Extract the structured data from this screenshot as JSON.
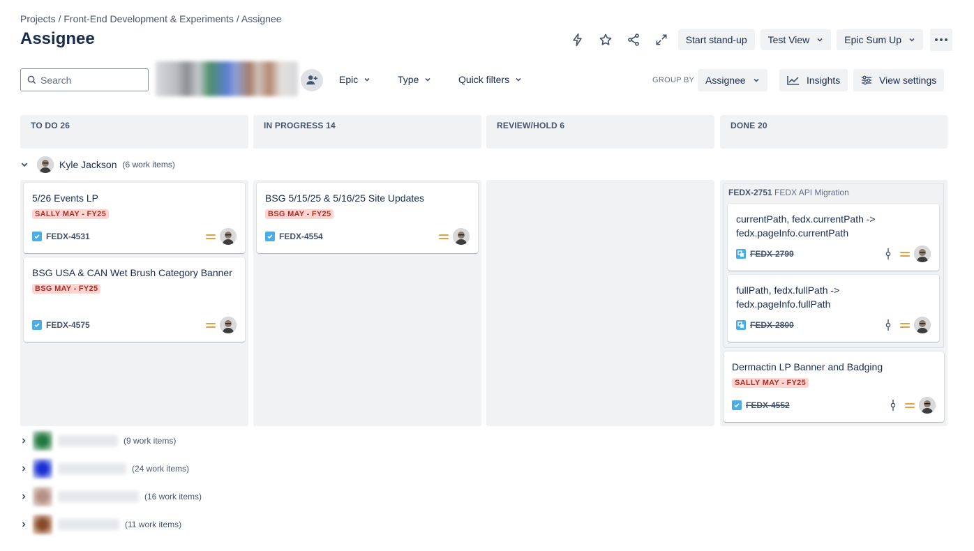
{
  "breadcrumb": {
    "items": [
      "Projects",
      "/ Front-End Development & Experiments",
      "/ Assignee"
    ]
  },
  "page": {
    "title": "Assignee"
  },
  "top_actions": {
    "standup": "Start stand-up",
    "test_view": "Test View",
    "epic_sum_up": "Epic Sum Up"
  },
  "toolbar": {
    "search_placeholder": "Search",
    "filters": {
      "epic": "Epic",
      "type": "Type",
      "quick_filters": "Quick filters"
    },
    "group_by_label": "GROUP BY",
    "group_by_value": "Assignee",
    "insights": "Insights",
    "view_settings": "View settings"
  },
  "columns": [
    {
      "label": "TO DO 26"
    },
    {
      "label": "IN PROGRESS 14"
    },
    {
      "label": "REVIEW/HOLD 6"
    },
    {
      "label": "DONE 20"
    }
  ],
  "swimlane": {
    "name": "Kyle Jackson",
    "count": "(6 work items)"
  },
  "cards": {
    "todo1": {
      "title": "5/26 Events LP",
      "label": "SALLY MAY - FY25",
      "key": "FEDX-4531"
    },
    "todo2": {
      "title": "BSG USA & CAN Wet Brush Category Banner",
      "label": "BSG MAY - FY25",
      "key": "FEDX-4575"
    },
    "inprog1": {
      "title": "BSG 5/15/25 & 5/16/25 Site Updates",
      "label": "BSG MAY - FY25",
      "key": "FEDX-4554"
    },
    "epic_group": {
      "key": "FEDX-2751",
      "name": "FEDX API Migration"
    },
    "done1": {
      "title": "currentPath, fedx.currentPath -> fedx.pageInfo.currentPath",
      "key": "FEDX-2799"
    },
    "done2": {
      "title": "fullPath, fedx.fullPath -> fedx.pageInfo.fullPath",
      "key": "FEDX-2800"
    },
    "done3": {
      "title": "Dermactin LP Banner and Badging",
      "label": "SALLY MAY - FY25",
      "key": "FEDX-4552"
    }
  },
  "collapsed_lanes": [
    {
      "count": "(9 work items)"
    },
    {
      "count": "(24 work items)"
    },
    {
      "count": "(16 work items)"
    },
    {
      "count": "(11 work items)"
    }
  ],
  "colors": {
    "label_bg": "#ffd5d2",
    "label_fg": "#ae2e24",
    "priority_medium": "#e2a03f",
    "task_icon": "#4bade8"
  }
}
